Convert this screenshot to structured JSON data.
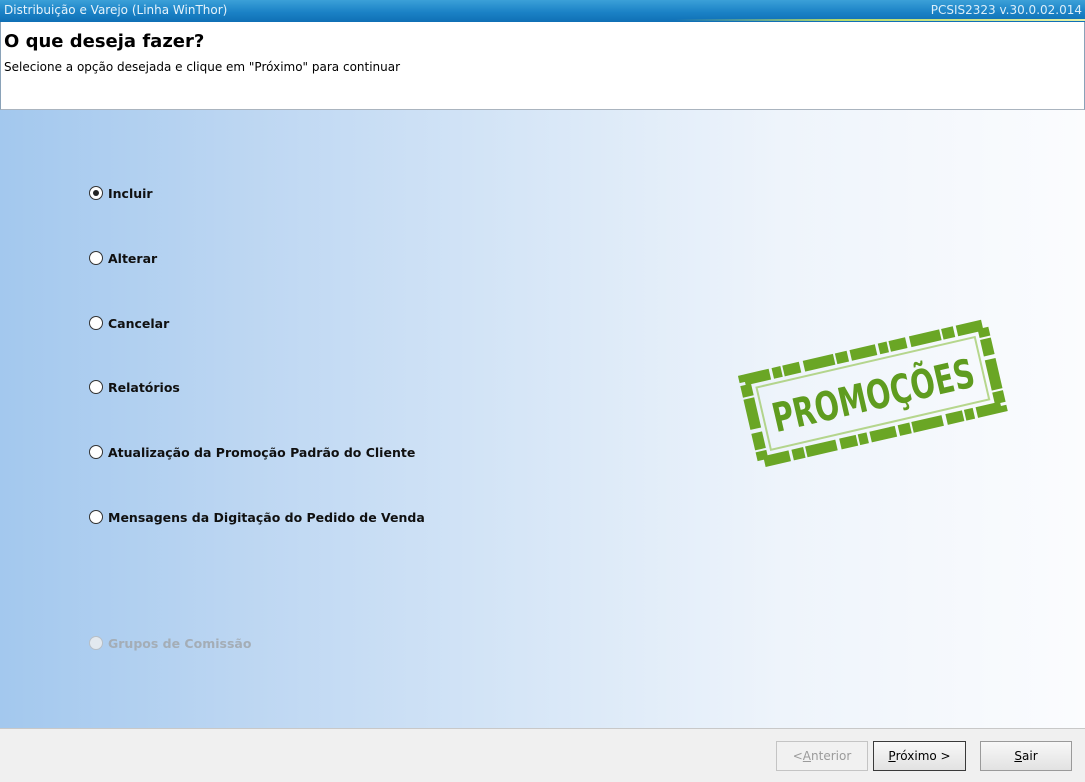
{
  "window": {
    "title": "Distribuição e Varejo (Linha WinThor)",
    "version": "PCSIS2323  v.30.0.02.014"
  },
  "header": {
    "title": "O que deseja fazer?",
    "subtitle": "Selecione a opção desejada e clique em \"Próximo\" para continuar"
  },
  "options": [
    {
      "label": "Incluir",
      "selected": true,
      "enabled": true
    },
    {
      "label": "Alterar",
      "selected": false,
      "enabled": true
    },
    {
      "label": "Cancelar",
      "selected": false,
      "enabled": true
    },
    {
      "label": "Relatórios",
      "selected": false,
      "enabled": true
    },
    {
      "label": "Atualização da Promoção Padrão do Cliente",
      "selected": false,
      "enabled": true
    },
    {
      "label": "Mensagens da Digitação do Pedido de Venda",
      "selected": false,
      "enabled": true
    },
    {
      "label": "Grupos de Comissão",
      "selected": false,
      "enabled": false
    }
  ],
  "stamp": {
    "text": "PROMOÇÕES",
    "color": "#6aa625"
  },
  "buttons": {
    "previous": {
      "prefix": "< ",
      "mnemonic": "A",
      "rest": "nterior",
      "enabled": false
    },
    "next": {
      "mnemonic": "P",
      "rest": "róximo >",
      "enabled": true
    },
    "exit": {
      "mnemonic": "S",
      "rest": "air",
      "enabled": true
    }
  }
}
